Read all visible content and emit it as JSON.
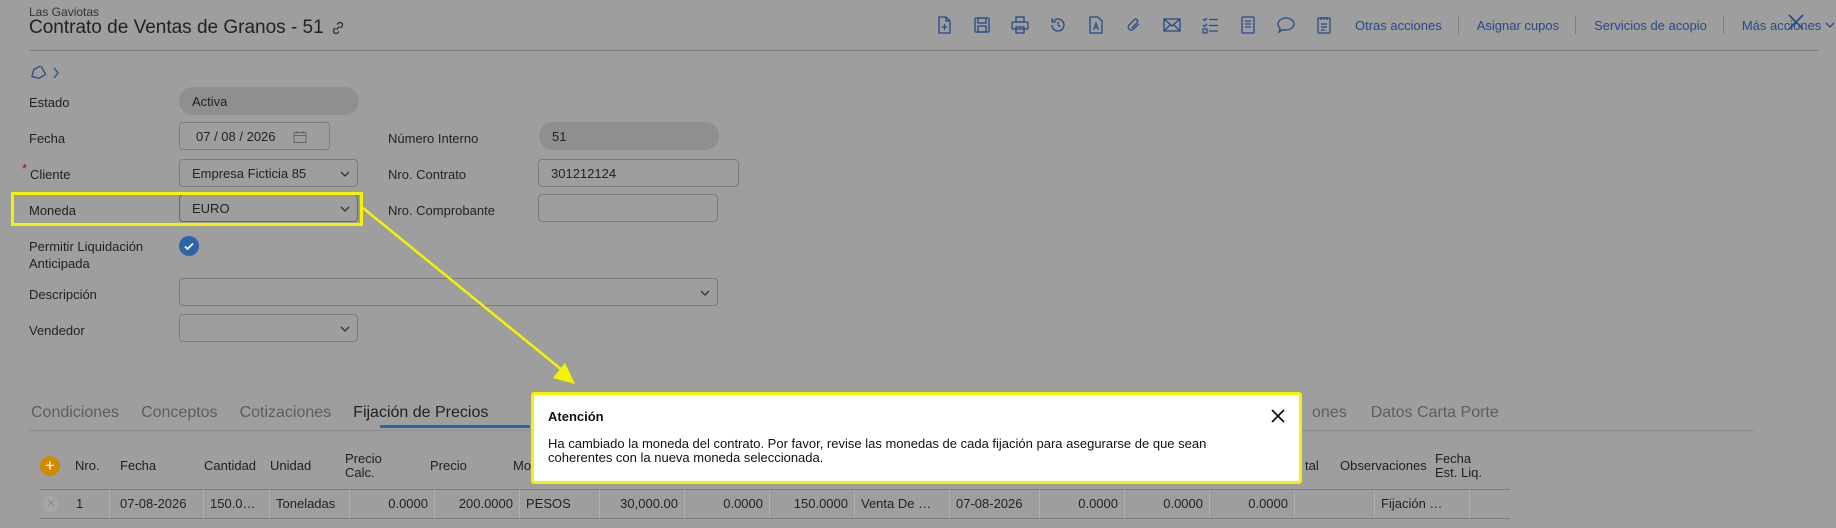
{
  "header": {
    "company": "Las Gaviotas",
    "title": "Contrato de Ventas de Granos - 51"
  },
  "toolbar": {
    "icons": [
      "new-document-icon",
      "save-icon",
      "print-icon",
      "history-icon",
      "text-document-icon",
      "attachment-icon",
      "email-icon",
      "checklist-icon",
      "report-icon",
      "comment-icon",
      "notes-icon"
    ],
    "links": {
      "otras_acciones": "Otras acciones",
      "asignar_cupos": "Asignar cupos",
      "servicios_acopio": "Servicios de acopio",
      "mas_acciones": "Más acciones"
    }
  },
  "form": {
    "estado": {
      "label": "Estado",
      "value": "Activa"
    },
    "fecha": {
      "label": "Fecha",
      "value": "07 / 08 / 2026"
    },
    "numero_interno": {
      "label": "Número Interno",
      "value": "51"
    },
    "cliente": {
      "label": "Cliente",
      "required_mark": "*",
      "value": "Empresa Ficticia 85"
    },
    "nro_contrato": {
      "label": "Nro. Contrato",
      "value": "301212124"
    },
    "moneda": {
      "label": "Moneda",
      "value": "EURO"
    },
    "nro_comprobante": {
      "label": "Nro. Comprobante",
      "value": ""
    },
    "permitir_liquidacion": {
      "label_line1": "Permitir Liquidación",
      "label_line2": "Anticipada",
      "checked": true
    },
    "descripcion": {
      "label": "Descripción",
      "value": ""
    },
    "vendedor": {
      "label": "Vendedor",
      "value": ""
    }
  },
  "tabs": {
    "items": [
      "Condiciones",
      "Conceptos",
      "Cotizaciones",
      "Fijación de Precios"
    ],
    "active": "Fijación de Precios",
    "right_partial": "ones",
    "right": "Datos Carta Porte"
  },
  "grid": {
    "headers": {
      "nro": "Nro.",
      "fecha": "Fecha",
      "cantidad": "Cantidad",
      "unidad": "Unidad",
      "precio_calc_1": "Precio",
      "precio_calc_2": "Calc.",
      "precio": "Precio",
      "mo": "Mo",
      "tal": "tal",
      "observaciones": "Observaciones",
      "fecha_est_1": "Fecha",
      "fecha_est_2": "Est. Liq."
    },
    "row": {
      "nro": "1",
      "fecha": "07-08-2026",
      "cantidad": "150.0…",
      "unidad": "Toneladas",
      "precio_calc": "0.0000",
      "precio": "200.0000",
      "moneda": "PESOS",
      "importe": "30,000.00",
      "c1": "0.0000",
      "c2": "150.0000",
      "tipo": "Venta De …",
      "fecha2": "07-08-2026",
      "c3": "0.0000",
      "c4": "0.0000",
      "c5": "0.0000",
      "c6": "",
      "observaciones": "Fijación …",
      "fecha_est": ""
    }
  },
  "dialog": {
    "title": "Atención",
    "message": "Ha cambiado la moneda del contrato. Por favor, revise las monedas de cada fijación para asegurarse de que sean coherentes con la nueva moneda seleccionada."
  },
  "colors": {
    "highlight": "#f4f400",
    "accent": "#2b66a8",
    "link": "#254a8a"
  }
}
